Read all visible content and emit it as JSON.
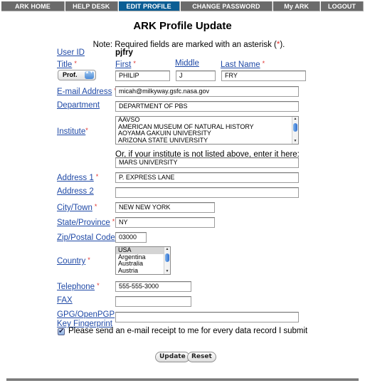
{
  "nav": {
    "items": [
      {
        "label": "ARK HOME",
        "active": false
      },
      {
        "label": "HELP DESK",
        "active": false
      },
      {
        "label": "EDIT PROFILE",
        "active": true
      },
      {
        "label": "CHANGE PASSWORD",
        "active": false
      },
      {
        "label": "My ARK",
        "active": false
      },
      {
        "label": "LOGOUT",
        "active": false
      }
    ]
  },
  "page": {
    "title": "ARK Profile Update",
    "note_prefix": "Note: Required fields are marked with an asterisk (",
    "note_asterisk": "*",
    "note_suffix": ")."
  },
  "form": {
    "required_mark": "*",
    "user_id": {
      "label": "User ID",
      "value": "pjfry"
    },
    "title": {
      "label": "Title",
      "value": "Prof.",
      "arrows": "▲▼"
    },
    "first": {
      "label": "First",
      "value": "PHILIP"
    },
    "middle": {
      "label": "Middle",
      "value": "J"
    },
    "last": {
      "label": "Last Name",
      "value": "FRY"
    },
    "email": {
      "label": "E-mail Address",
      "value": "micah@milkyway.gsfc.nasa.gov"
    },
    "department": {
      "label": "Department",
      "value": "DEPARTMENT OF PBS"
    },
    "institute": {
      "label": "Institute",
      "options": [
        "AAVSO",
        "AMERICAN MUSEUM OF NATURAL HISTORY",
        "AOYAMA GAKUIN UNIVERSITY",
        "ARIZONA STATE UNIVERSITY"
      ],
      "other_note": "Or, if your institute is not listed above, enter it here:",
      "other_value": "MARS UNIVERSITY"
    },
    "address1": {
      "label": "Address 1",
      "value": "P. EXPRESS LANE"
    },
    "address2": {
      "label": "Address 2",
      "value": ""
    },
    "city": {
      "label": "City/Town",
      "value": "NEW NEW YORK"
    },
    "state": {
      "label": "State/Province",
      "value": "NY"
    },
    "zip": {
      "label": "Zip/Postal Code",
      "value": "03000"
    },
    "country": {
      "label": "Country",
      "options": [
        "USA",
        "Argentina",
        "Australia",
        "Austria"
      ],
      "selected": "USA"
    },
    "telephone": {
      "label": "Telephone",
      "value": "555-555-3000"
    },
    "fax": {
      "label": "FAX",
      "value": ""
    },
    "gpg": {
      "label_line1": "GPG/OpenPGP",
      "label_line2": "Key Fingerprint",
      "value": ""
    },
    "receipt": {
      "checked": true,
      "check_glyph": "✔",
      "label": "Please send an e-mail receipt to me for every data record I submit"
    },
    "buttons": {
      "update": "Update",
      "reset": "Reset"
    }
  },
  "scroll": {
    "up": "▲",
    "down": "▼"
  }
}
